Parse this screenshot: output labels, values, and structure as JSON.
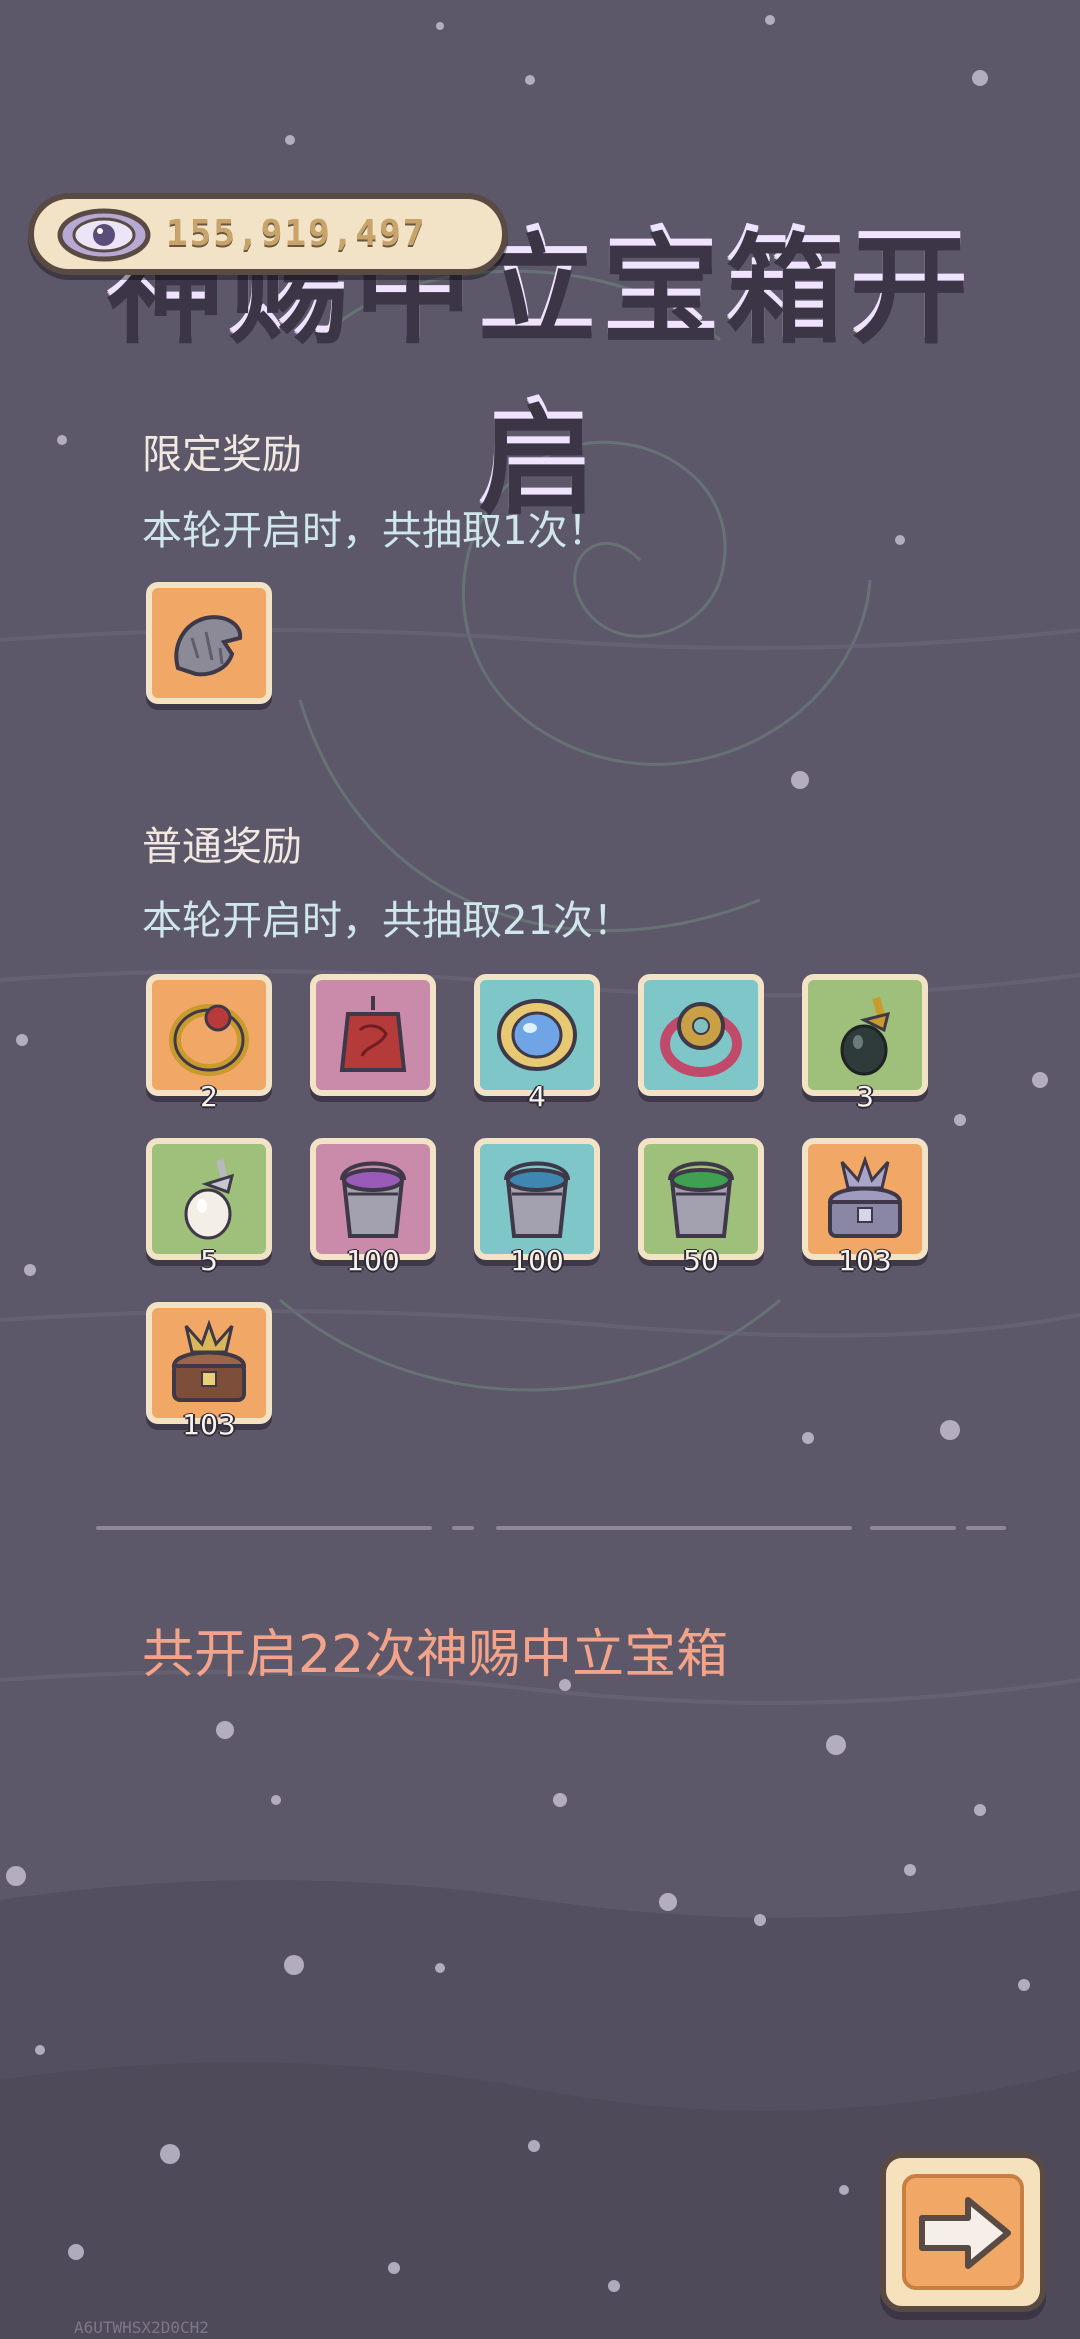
{
  "title": "神赐中立宝箱开启",
  "currency": {
    "amount": "155,919,497",
    "icon": "eye-icon"
  },
  "limited": {
    "heading": "限定奖励",
    "subtitle": "本轮开启时，共抽取1次！",
    "items": [
      {
        "icon": "stone-relic-icon",
        "color": "orange",
        "qty": ""
      }
    ]
  },
  "normal": {
    "heading": "普通奖励",
    "subtitle": "本轮开启时，共抽取21次！",
    "items": [
      {
        "icon": "ruby-ring-icon",
        "color": "orange",
        "qty": "2"
      },
      {
        "icon": "red-amulet-icon",
        "color": "pink",
        "qty": ""
      },
      {
        "icon": "sapphire-brooch-icon",
        "color": "blue",
        "qty": "4"
      },
      {
        "icon": "flower-ring-icon",
        "color": "blue",
        "qty": ""
      },
      {
        "icon": "black-pearl-pendant-icon",
        "color": "green",
        "qty": "3"
      },
      {
        "icon": "white-pearl-pendant-icon",
        "color": "green",
        "qty": "5"
      },
      {
        "icon": "purple-paint-bucket-icon",
        "color": "pink",
        "qty": "100"
      },
      {
        "icon": "blue-paint-bucket-icon",
        "color": "blue",
        "qty": "100"
      },
      {
        "icon": "green-paint-bucket-icon",
        "color": "green",
        "qty": "50"
      },
      {
        "icon": "dragon-chest-icon",
        "color": "orange",
        "qty": "103"
      },
      {
        "icon": "golden-dragon-chest-icon",
        "color": "orange",
        "qty": "103"
      }
    ]
  },
  "summary": "共开启22次神赐中立宝箱",
  "next_button": {
    "icon": "arrow-right-icon"
  },
  "watermark": "A6UTWHSX2D0CH2",
  "colors": {
    "background": "#5d5869",
    "slot_border": "#f3e3c6",
    "summary_text": "#f2a389",
    "subtitle_text": "#cfe6ea"
  }
}
